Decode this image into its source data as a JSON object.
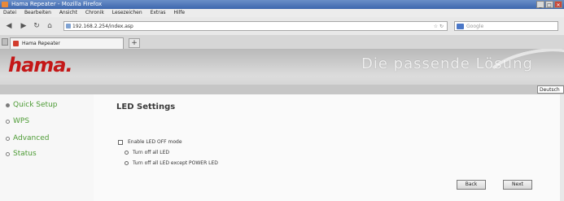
{
  "browser": {
    "window_title": "Hama Repeater - Mozilla Firefox",
    "menu": [
      "Datei",
      "Bearbeiten",
      "Ansicht",
      "Chronik",
      "Lesezeichen",
      "Extras",
      "Hilfe"
    ],
    "url": "192.168.2.254/index.asp",
    "search_placeholder": "Google",
    "tab_title": "Hama Repeater",
    "new_tab": "+",
    "win_minimize": "_",
    "win_maximize": "□",
    "win_close": "✕"
  },
  "header": {
    "logo": "hama",
    "logo_dot": ".",
    "slogan": "Die passende Lösung",
    "language": "Deutsch"
  },
  "sidebar": {
    "items": [
      {
        "label": "Quick Setup",
        "selected": true
      },
      {
        "label": "WPS",
        "selected": false
      },
      {
        "label": "Advanced",
        "selected": false
      },
      {
        "label": "Status",
        "selected": false
      }
    ]
  },
  "main": {
    "title": "LED Settings",
    "enable_led_off_label": "Enable LED OFF mode",
    "option_all_label": "Turn off all LED",
    "option_except_power_label": "Turn off all LED except POWER LED",
    "back_label": "Back",
    "next_label": "Next"
  },
  "colors": {
    "brand": "#c41717",
    "nav_text": "#4d9b35"
  }
}
